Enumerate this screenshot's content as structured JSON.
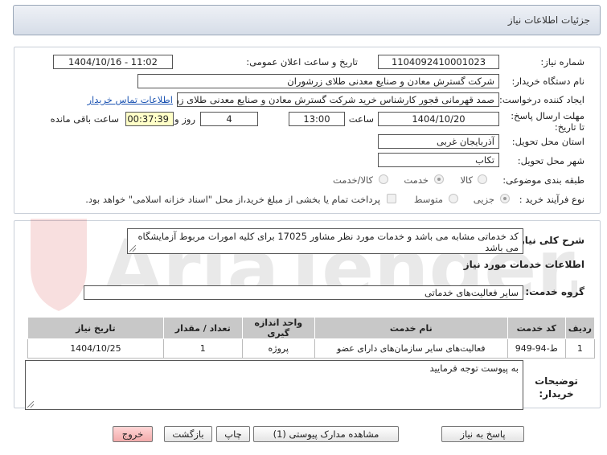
{
  "header": {
    "title": "جزئیات اطلاعات نیاز"
  },
  "form": {
    "need_number_label": "شماره نیاز:",
    "need_number": "1104092410001023",
    "announce_label": "تاریخ و ساعت اعلان عمومی:",
    "announce_value": "1404/10/16 - 11:02",
    "buyer_org_label": "نام دستگاه خریدار:",
    "buyer_org": "شرکت گسترش معادن و صنایع معدنی طلای زرشوران",
    "creator_label": "ایجاد کننده درخواست:",
    "creator": "صمد قهرمانی قجور کارشناس خرید شرکت گسترش معادن و صنایع معدنی طلای زرشوران",
    "contact_link": "اطلاعات تماس خریدار",
    "deadline_label": "مهلت ارسال پاسخ: تا تاریخ:",
    "deadline_date": "1404/10/20",
    "time_label": "ساعت",
    "deadline_time": "13:00",
    "days_value": "4",
    "days_label": "روز و",
    "remaining_time": "00:37:39",
    "remaining_label": "ساعت باقی مانده",
    "province_label": "استان محل تحویل:",
    "province": "آذربایجان غربی",
    "city_label": "شهر محل تحویل:",
    "city": "تکاب",
    "category_label": "طبقه بندی موضوعی:",
    "category_options": [
      "کالا",
      "خدمت",
      "کالا/خدمت"
    ],
    "category_selected": "خدمت",
    "process_label": "نوع فرآیند خرید :",
    "process_options": [
      "جزیی",
      "متوسط"
    ],
    "process_selected": "جزیی",
    "payment_note": "پرداخت تمام یا بخشی از مبلغ خرید،از محل \"اسناد خزانه اسلامی\" خواهد بود."
  },
  "details": {
    "summary_label": "شرح کلی نیاز:",
    "summary": "کد خدماتی مشابه می باشد و خدمات مورد نظر مشاور 17025 برای کلیه امورات مربوط آزمایشگاه می باشد",
    "services_heading": "اطلاعات خدمات مورد نیاز",
    "service_group_label": "گروه خدمت:",
    "service_group": "سایر فعالیت‌های خدماتی",
    "table": {
      "headers": [
        "ردیف",
        "کد خدمت",
        "نام خدمت",
        "واحد اندازه گیری",
        "تعداد / مقدار",
        "تاریخ نیاز"
      ],
      "rows": [
        [
          "1",
          "ط-94-949",
          "فعالیت‌های سایر سازمان‌های دارای عضو",
          "پروژه",
          "1",
          "1404/10/25"
        ]
      ]
    },
    "buyer_notes_label": "توضیحات خریدار:",
    "buyer_notes": "به پیوست توجه فرمایید"
  },
  "buttons": {
    "reply": "پاسخ به نیاز",
    "attachments": "مشاهده مدارک پیوستی (1)",
    "print": "چاپ",
    "back": "بازگشت",
    "exit": "خروج"
  },
  "colors": {
    "highlight": "#ffffc8",
    "link": "#1f56b3",
    "header_bg": "#d6dde8",
    "exit_bg": "#f2aaaa"
  },
  "watermark": "AriaTender.net"
}
